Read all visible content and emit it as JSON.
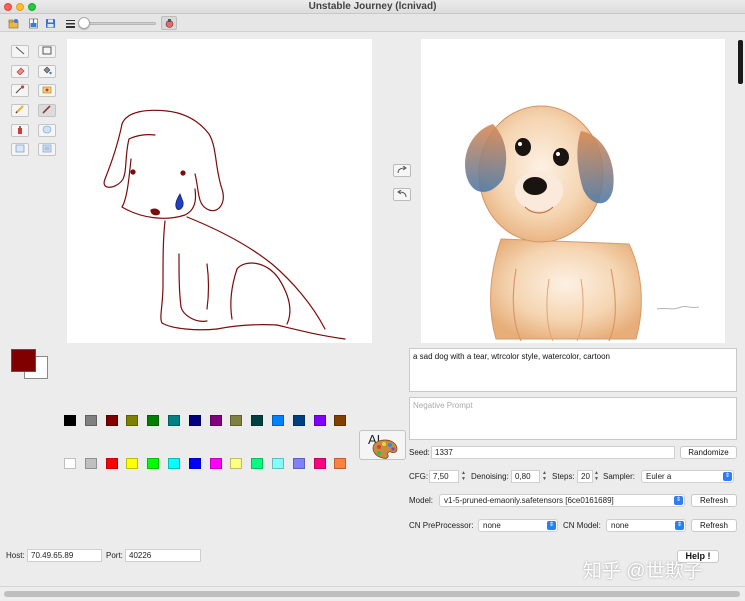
{
  "window": {
    "title": "Unstable Journey (lcnivad)"
  },
  "toolbar": {
    "items": [
      "open-icon",
      "import-icon",
      "save-icon",
      "line-width-icon",
      "slider",
      "settings-icon"
    ]
  },
  "tools": [
    "line-icon",
    "rectangle-icon",
    "eraser-icon",
    "fill-icon",
    "color-picker-icon",
    "stamp-icon",
    "pencil-icon",
    "brush-icon",
    "spray-icon",
    "blur-icon",
    "select-icon",
    "select-all-icon"
  ],
  "arrows": [
    "redo-arrow-icon",
    "undo-arrow-icon"
  ],
  "colors": {
    "foreground": "#800000",
    "background": "#ffffff",
    "palette_row1": [
      "#000000",
      "#808080",
      "#800000",
      "#808000",
      "#008000",
      "#008080",
      "#000080",
      "#800080",
      "#808040",
      "#004040",
      "#0080ff",
      "#004080",
      "#8000ff",
      "#804000"
    ],
    "palette_row2": [
      "#ffffff",
      "#c0c0c0",
      "#ff0000",
      "#ffff00",
      "#00ff00",
      "#00ffff",
      "#0000ff",
      "#ff00ff",
      "#ffff80",
      "#00ff80",
      "#80ffff",
      "#8080ff",
      "#ff0080",
      "#ff8040"
    ]
  },
  "ai_button": {
    "label": "AI",
    "icon": "palette-icon"
  },
  "prompt": {
    "value": "a sad dog with a tear, wtrcolor style, watercolor, cartoon"
  },
  "negative_prompt": {
    "placeholder": "Negative Prompt",
    "value": ""
  },
  "seed": {
    "label": "Seed:",
    "value": "1337",
    "randomize_label": "Randomize"
  },
  "cfg": {
    "label": "CFG:",
    "value": "7,50"
  },
  "denoising": {
    "label": "Denoising:",
    "value": "0,80"
  },
  "steps": {
    "label": "Steps:",
    "value": "20"
  },
  "sampler": {
    "label": "Sampler:",
    "value": "Euler a"
  },
  "model": {
    "label": "Model:",
    "value": "v1-5-pruned-emaonly.safetensors [6ce0161689]",
    "refresh_label": "Refresh"
  },
  "cn_preprocessor": {
    "label": "CN PreProcessor:",
    "value": "none"
  },
  "cn_model": {
    "label": "CN Model:",
    "value": "none",
    "refresh_label": "Refresh"
  },
  "host": {
    "label": "Host:",
    "value": "70.49.65.89"
  },
  "port": {
    "label": "Port:",
    "value": "40226"
  },
  "help": {
    "label": "Help !"
  },
  "watermark": {
    "text": "知乎 @世欺子"
  }
}
